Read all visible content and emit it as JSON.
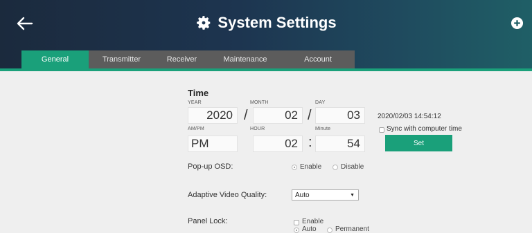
{
  "header": {
    "title": "System Settings",
    "back_icon": "arrow-left-icon",
    "add_icon": "plus-circle-icon",
    "title_icon": "gear-icon"
  },
  "tabs": [
    {
      "label": "General",
      "active": true
    },
    {
      "label": "Transmitter",
      "active": false
    },
    {
      "label": "Receiver",
      "active": false
    },
    {
      "label": "Maintenance",
      "active": false
    },
    {
      "label": "Account",
      "active": false
    }
  ],
  "time": {
    "section_title": "Time",
    "year_label": "YEAR",
    "month_label": "MONTH",
    "day_label": "DAY",
    "year": "2020",
    "month": "02",
    "day": "03",
    "date_sep": "/",
    "ampm_label": "AM/PM",
    "hour_label": "HOUR",
    "minute_label": "Minute",
    "ampm": "PM",
    "hour": "02",
    "minute": "54",
    "time_sep": ":",
    "current_datetime": "2020/02/03 14:54:12",
    "sync_label": "Sync with computer time",
    "sync_checked": false,
    "set_label": "Set"
  },
  "popup_osd": {
    "label": "Pop-up OSD:",
    "enable_label": "Enable",
    "disable_label": "Disable",
    "selected": "Enable"
  },
  "adaptive_video": {
    "label": "Adaptive Video Quality:",
    "value": "Auto"
  },
  "panel_lock": {
    "label": "Panel Lock:",
    "enable_label": "Enable",
    "auto_label": "Auto",
    "permanent_label": "Permanent",
    "enable_checked": false,
    "mode": "Auto"
  },
  "colors": {
    "accent": "#1aa07a",
    "header_dark": "#1b2a3d",
    "tab_bg": "#5c5c5c",
    "page_bg": "#efefef"
  }
}
